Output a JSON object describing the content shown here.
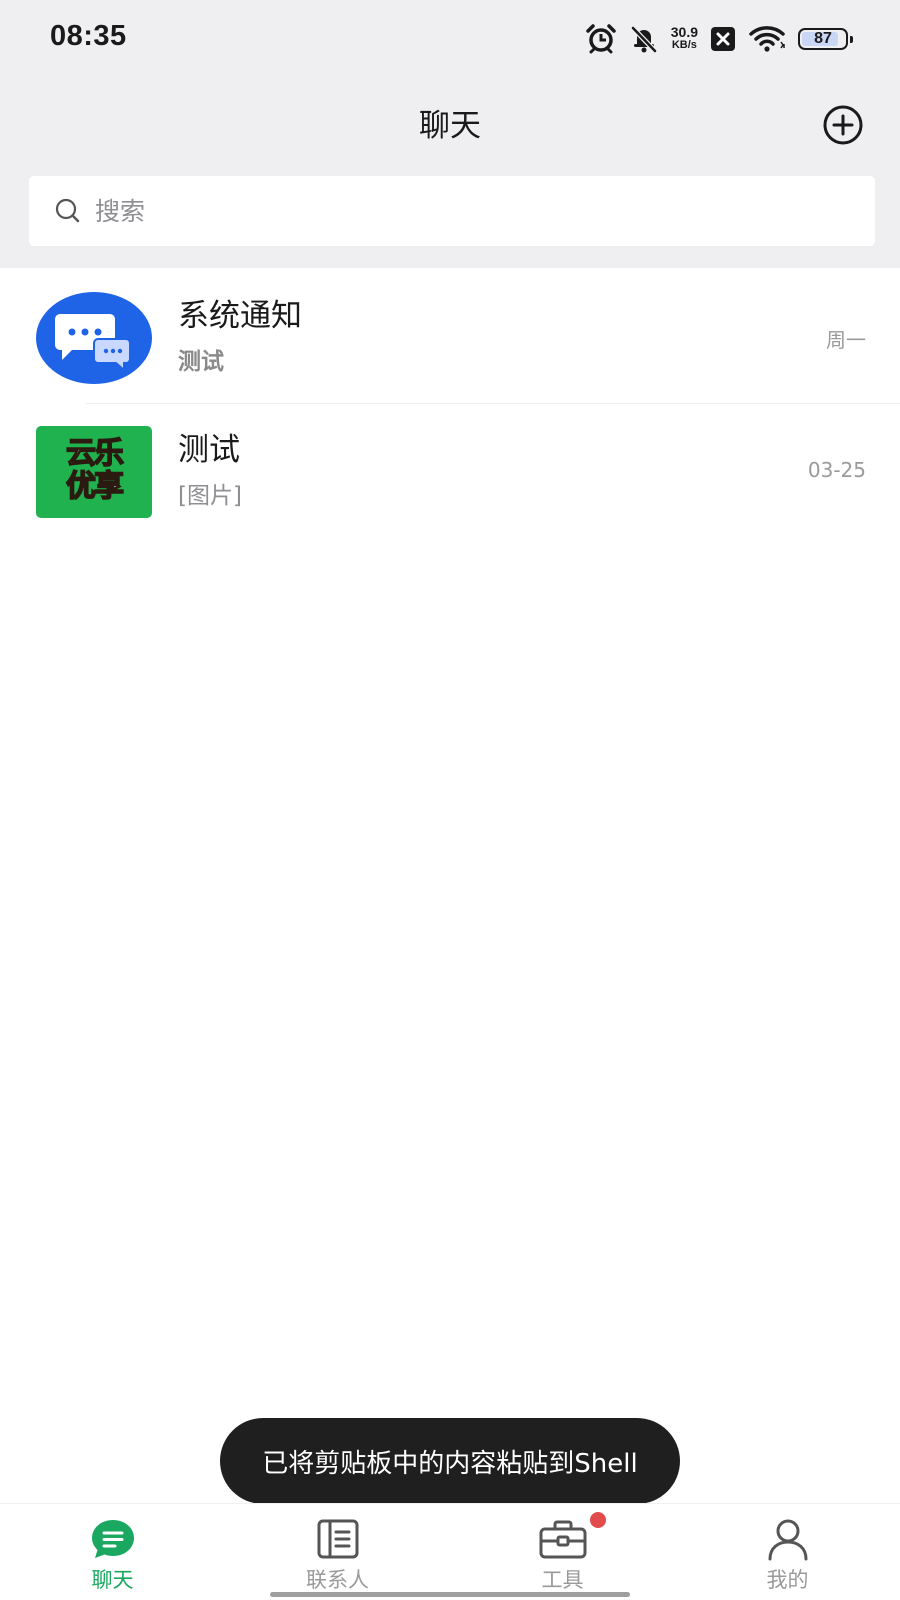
{
  "status_bar": {
    "time": "08:35",
    "net_speed_value": "30.9",
    "net_speed_unit": "KB/s",
    "battery_level": "87",
    "icons": [
      "alarm-icon",
      "bell-off-icon",
      "x-app-icon",
      "wifi-icon",
      "battery-icon"
    ]
  },
  "header": {
    "title": "聊天",
    "add_icon": "add-circle-icon"
  },
  "search": {
    "placeholder": "搜索",
    "icon": "search-icon"
  },
  "chats": [
    {
      "name": "系统通知",
      "preview": "测试",
      "time": "周一",
      "avatar": "chat-bubbles-icon",
      "avatar_color": "#1f63e6"
    },
    {
      "name": "测试",
      "preview": "[图片]",
      "time": "03-25",
      "avatar_logo_line1": "云乐",
      "avatar_logo_line2": "优享",
      "avatar_color": "#1fb24e"
    }
  ],
  "toast": {
    "message": "已将剪贴板中的内容粘贴到Shell"
  },
  "bottom_nav": {
    "items": [
      {
        "label": "聊天",
        "icon": "chat-icon",
        "active": true
      },
      {
        "label": "联系人",
        "icon": "contacts-icon",
        "active": false
      },
      {
        "label": "工具",
        "icon": "toolbox-icon",
        "active": false,
        "badge": true
      },
      {
        "label": "我的",
        "icon": "profile-icon",
        "active": false
      }
    ]
  },
  "colors": {
    "accent": "#1aa860",
    "badge": "#e14b4b",
    "header_bg": "#efeff1",
    "toast_bg": "#1f1f1f"
  }
}
